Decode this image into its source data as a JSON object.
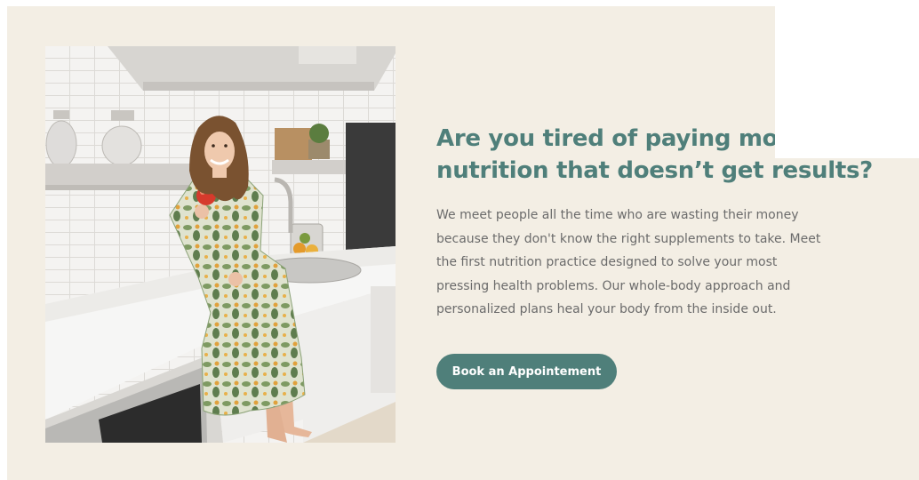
{
  "hero": {
    "heading_lines": [
      "Are you tired of paying money for",
      "nutrition that doesn’t get results?"
    ],
    "body_lines": [
      "We meet people all the time who are wasting their money",
      "because they don't know the right supplements to take. Meet",
      "the first nutrition practice designed to solve your most",
      "pressing health problems. Our whole-body approach and",
      "personalized plans heal your body from the inside out."
    ],
    "cta_label": "Book an Appointement"
  },
  "colors": {
    "background": "#f3eee4",
    "accent": "#4f7f7a",
    "body_text": "#6b6b6b",
    "button_text": "#ffffff"
  }
}
